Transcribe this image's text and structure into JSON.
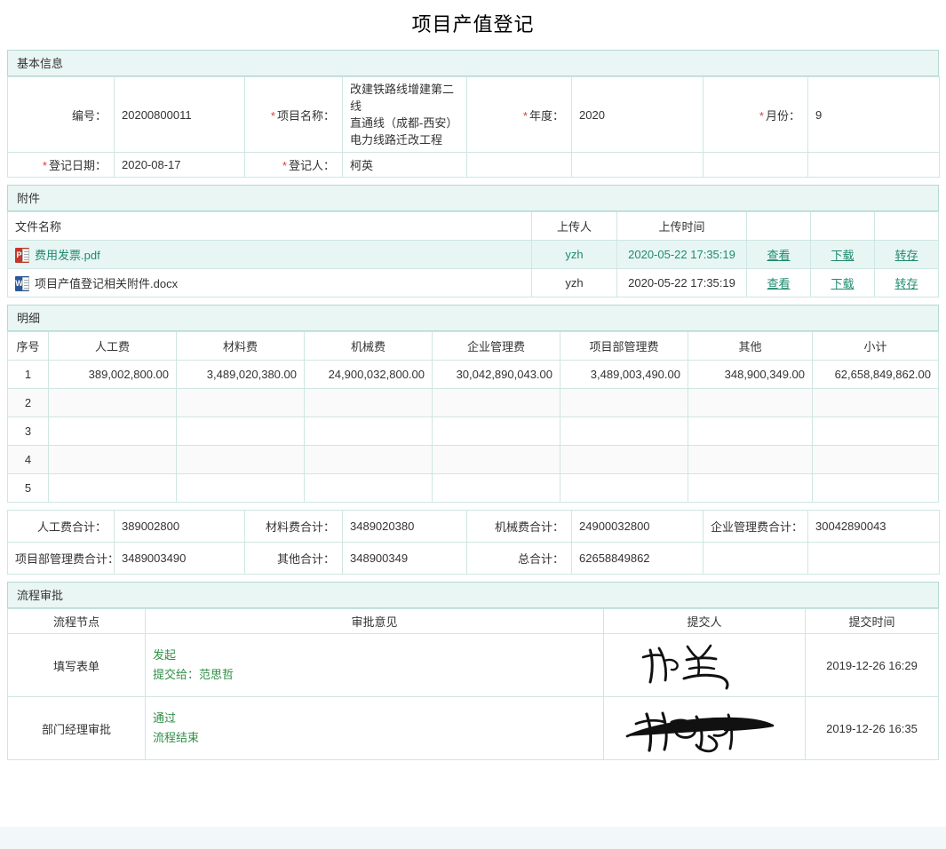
{
  "page": {
    "title": "项目产值登记"
  },
  "basic": {
    "section_label": "基本信息",
    "fields": {
      "code_label": "编号：",
      "code_value": "20200800011",
      "project_label": "项目名称：",
      "project_value": "改建铁路线增建第二线直通线（成都-西安）电力线路迁改工程",
      "project_line1": "改建铁路线增建第二线",
      "project_line2": "直通线（成都-西安）",
      "project_line3": "电力线路迁改工程",
      "year_label": "年度：",
      "year_value": "2020",
      "month_label": "月份：",
      "month_value": "9",
      "regdate_label": "登记日期：",
      "regdate_value": "2020-08-17",
      "registrant_label": "登记人：",
      "registrant_value": "柯英"
    }
  },
  "attachment": {
    "section_label": "附件",
    "columns": [
      "文件名称",
      "上传人",
      "上传时间",
      "",
      "",
      ""
    ],
    "actions": {
      "view": "查看",
      "download": "下载",
      "save": "转存"
    },
    "rows": [
      {
        "icon": "pdf-file-icon",
        "name": "费用发票.pdf",
        "uploader": "yzh",
        "time": "2020-05-22 17:35:19",
        "highlight": true
      },
      {
        "icon": "word-file-icon",
        "name": "项目产值登记相关附件.docx",
        "uploader": "yzh",
        "time": "2020-05-22 17:35:19",
        "highlight": false
      }
    ]
  },
  "detail": {
    "section_label": "明细",
    "columns": [
      "序号",
      "人工费",
      "材料费",
      "机械费",
      "企业管理费",
      "项目部管理费",
      "其他",
      "小计"
    ],
    "rows": [
      {
        "idx": "1",
        "labor": "389,002,800.00",
        "material": "3,489,020,380.00",
        "machine": "24,900,032,800.00",
        "enterprise": "30,042,890,043.00",
        "deptmgmt": "3,489,003,490.00",
        "other": "348,900,349.00",
        "subtotal": "62,658,849,862.00"
      },
      {
        "idx": "2",
        "labor": "",
        "material": "",
        "machine": "",
        "enterprise": "",
        "deptmgmt": "",
        "other": "",
        "subtotal": ""
      },
      {
        "idx": "3",
        "labor": "",
        "material": "",
        "machine": "",
        "enterprise": "",
        "deptmgmt": "",
        "other": "",
        "subtotal": ""
      },
      {
        "idx": "4",
        "labor": "",
        "material": "",
        "machine": "",
        "enterprise": "",
        "deptmgmt": "",
        "other": "",
        "subtotal": ""
      },
      {
        "idx": "5",
        "labor": "",
        "material": "",
        "machine": "",
        "enterprise": "",
        "deptmgmt": "",
        "other": "",
        "subtotal": ""
      }
    ]
  },
  "sums": {
    "labor_label": "人工费合计：",
    "labor_value": "389002800",
    "material_label": "材料费合计：",
    "material_value": "3489020380",
    "machine_label": "机械费合计：",
    "machine_value": "24900032800",
    "enterprise_label": "企业管理费合计：",
    "enterprise_value": "30042890043",
    "deptmgmt_label": "项目部管理费合计：",
    "deptmgmt_value": "3489003490",
    "other_label": "其他合计：",
    "other_value": "348900349",
    "total_label": "总合计：",
    "total_value": "62658849862"
  },
  "workflow": {
    "section_label": "流程审批",
    "columns": [
      "流程节点",
      "审批意见",
      "提交人",
      "提交时间"
    ],
    "rows": [
      {
        "node": "填写表单",
        "opinion_line1": "发起",
        "opinion_line2": "提交给：范思哲",
        "signature": "柯英",
        "time": "2019-12-26 16:29"
      },
      {
        "node": "部门经理审批",
        "opinion_line1": "通过",
        "opinion_line2": "流程结束",
        "signature": "范思哲",
        "time": "2019-12-26 16:35"
      }
    ]
  },
  "colors": {
    "section_header_bg": "#eaf6f4",
    "section_border": "#b4d9d3",
    "grid_border": "#cfe6e2",
    "required_star": "#e4393c",
    "link": "#1f8a70",
    "opinion_text": "#2f8f46",
    "row_highlight": "#e8f6f3",
    "footer_bar": "#f2f7fa"
  }
}
